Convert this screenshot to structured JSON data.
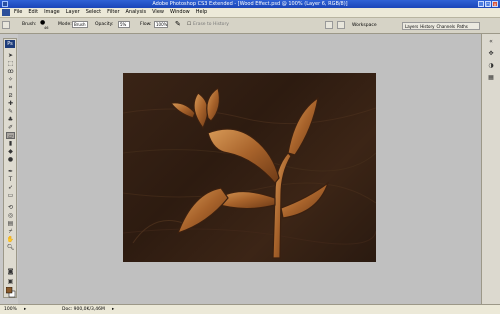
{
  "titlebar": {
    "title": "Adobe Photoshop CS3 Extended - [Wood Effect.psd @ 100% (Layer 6, RGB/8)]"
  },
  "menu": [
    "File",
    "Edit",
    "Image",
    "Layer",
    "Select",
    "Filter",
    "Analysis",
    "View",
    "Window",
    "Help"
  ],
  "options": {
    "brush_label": "Brush:",
    "brush_size": "46",
    "mode_label": "Mode:",
    "mode_value": "Brush",
    "opacity_label": "Opacity:",
    "opacity_value": "5%",
    "flow_label": "Flow:",
    "flow_value": "100%",
    "erase_history": "Erase to History",
    "workspace": "Workspace"
  },
  "panels": [
    "Layers",
    "History",
    "Channels",
    "Paths"
  ],
  "status": {
    "zoom": "100%",
    "doc": "Doc: 900,0K/3,46M"
  },
  "colors": {
    "foreground": "#8a5a2b",
    "background": "#ffffff"
  }
}
